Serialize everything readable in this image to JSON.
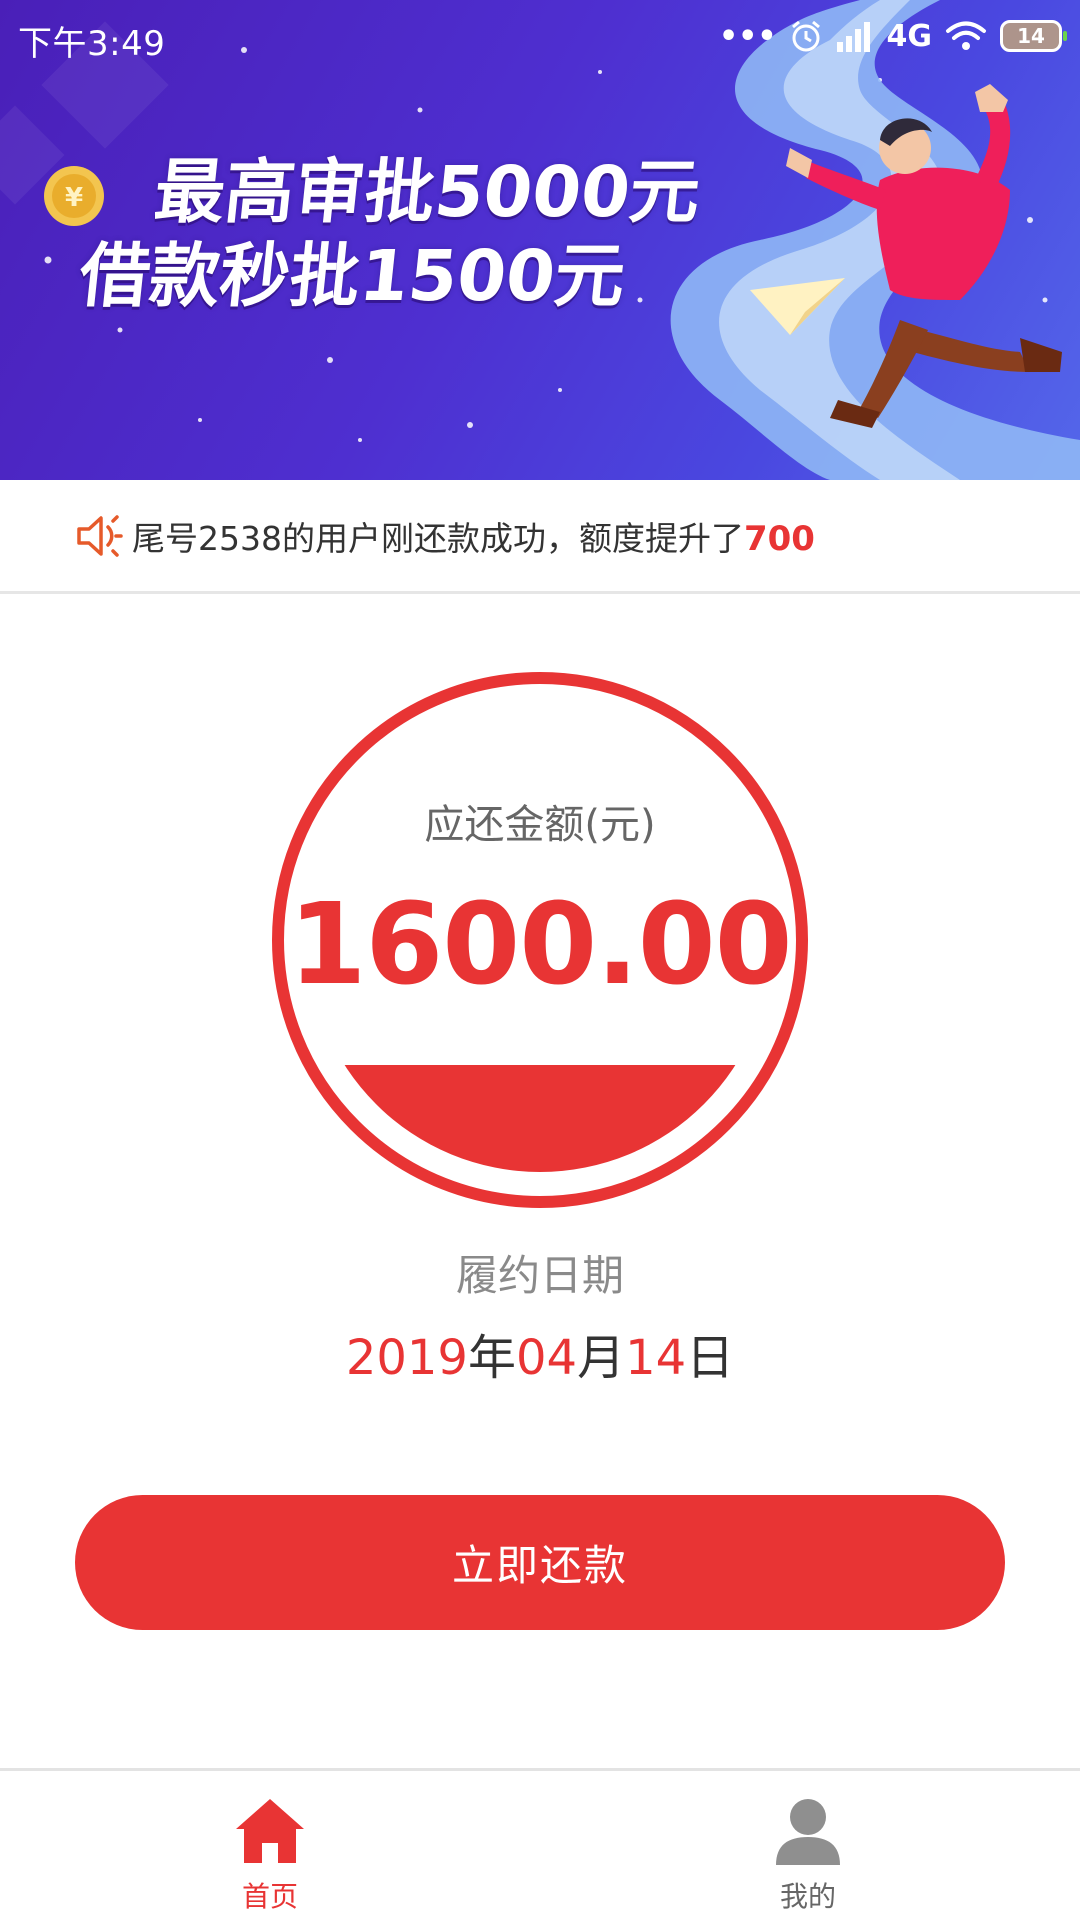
{
  "status_bar": {
    "time": "下午3:49",
    "network": "4G",
    "battery": "14"
  },
  "banner": {
    "line1": "最高审批5000元",
    "line2": "借款秒批1500元"
  },
  "notice": {
    "text": "尾号2538的用户刚还款成功，额度提升了",
    "amount": "700"
  },
  "repayment": {
    "label": "应还金额(元)",
    "amount": "1600.00"
  },
  "due": {
    "label": "履约日期",
    "year": "2019",
    "year_unit": "年",
    "month": "04",
    "month_unit": "月",
    "day": "14",
    "day_unit": "日"
  },
  "actions": {
    "repay_label": "立即还款"
  },
  "tabbar": {
    "items": [
      {
        "label": "首页",
        "icon": "home-icon",
        "active": true
      },
      {
        "label": "我的",
        "icon": "user-icon",
        "active": false
      }
    ]
  },
  "colors": {
    "accent": "#e83434",
    "banner": "#4e2fd0"
  }
}
